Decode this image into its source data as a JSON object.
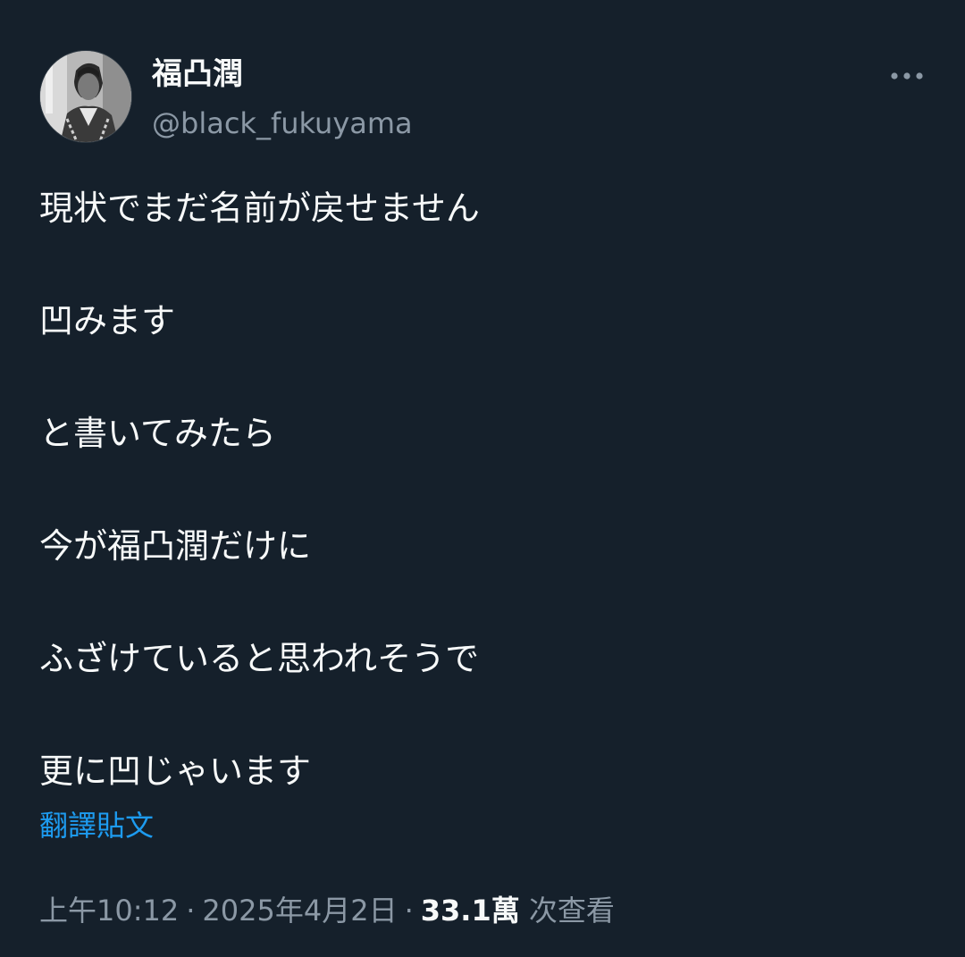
{
  "user": {
    "display_name": "福凸潤",
    "handle": "@black_fukuyama",
    "avatar_icon": "profile-photo"
  },
  "more_icon": "more-options-icon",
  "tweet": {
    "lines": [
      "現状でまだ名前が戻せません",
      "凹みます",
      "と書いてみたら",
      "今が福凸潤だけに",
      "ふざけていると思われそうで",
      "更に凹じゃいます"
    ],
    "translate_label": "翻譯貼文"
  },
  "meta": {
    "time": "上午10:12",
    "separator": "·",
    "date": "2025年4月2日",
    "views_count": "33.1萬",
    "views_label": "次查看"
  },
  "colors": {
    "background": "#15202b",
    "text_primary": "#f7f9f9",
    "text_secondary": "#8b98a5",
    "link": "#1d9bf0"
  }
}
